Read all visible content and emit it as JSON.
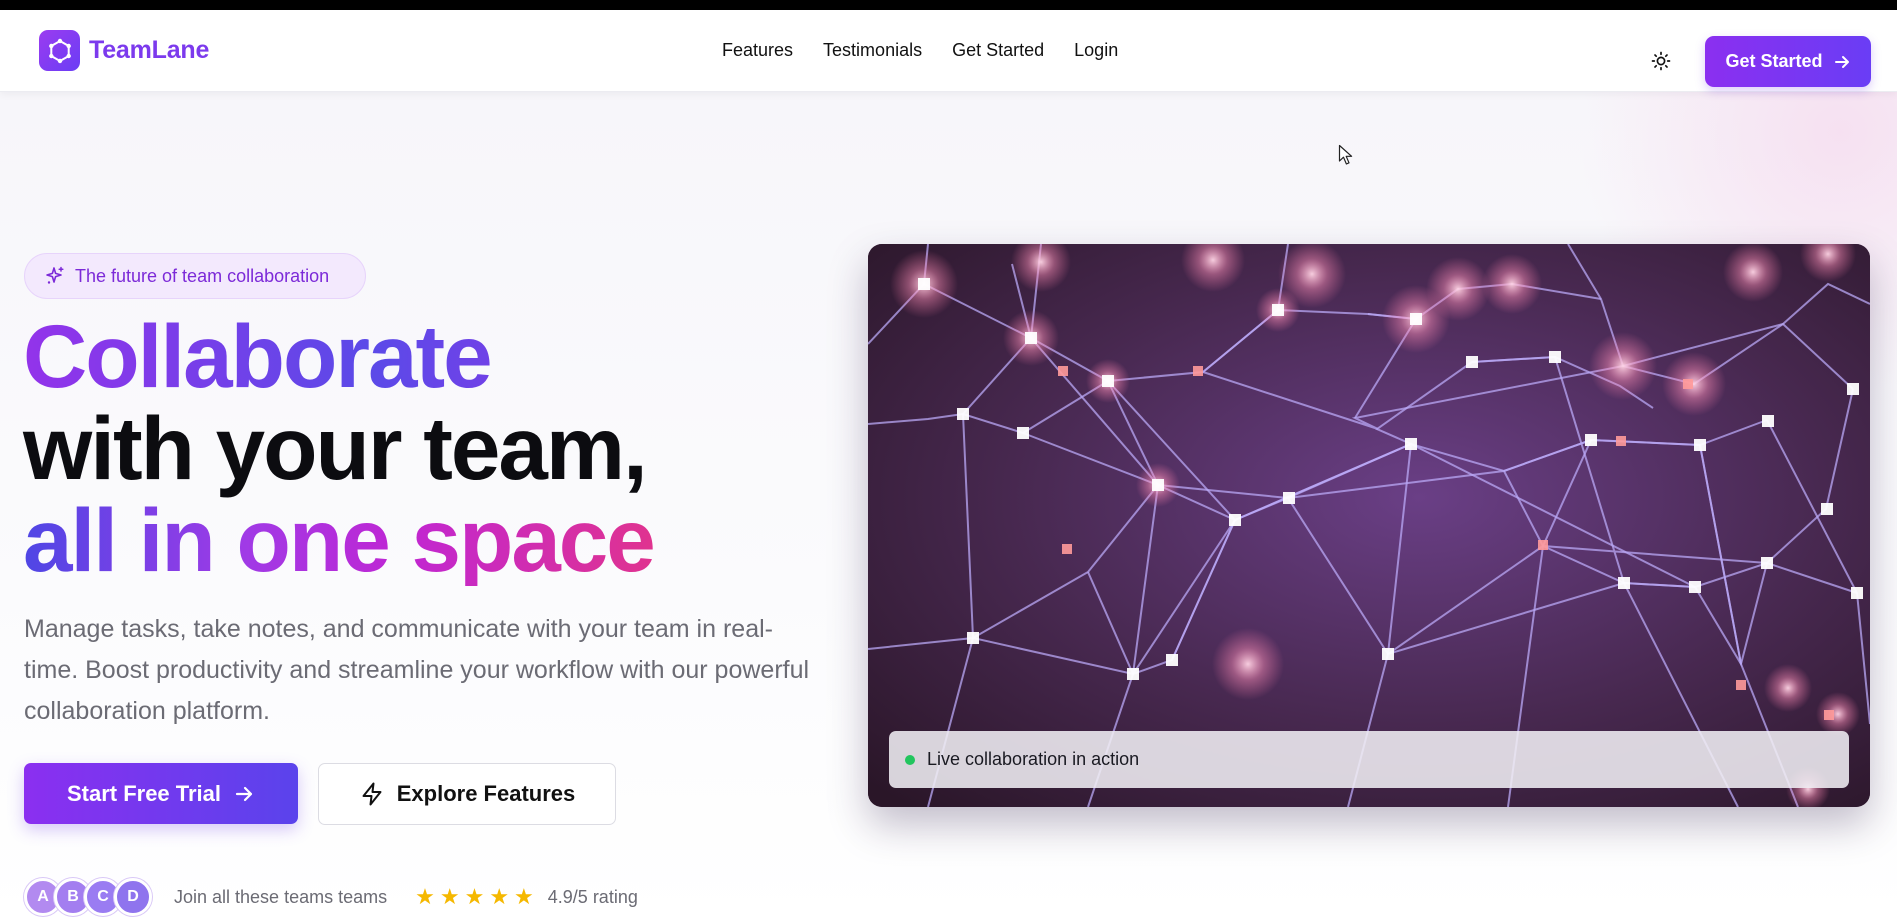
{
  "brand": {
    "name": "TeamLane",
    "logo_icon": "hexagon-network-icon"
  },
  "nav": {
    "links": [
      "Features",
      "Testimonials",
      "Get Started",
      "Login"
    ],
    "cta_label": "Get Started",
    "theme_icon": "sun-icon"
  },
  "hero": {
    "badge": "The future of team collaboration",
    "headline": {
      "line1": "Collaborate",
      "line2": "with your team,",
      "line3": "all in one space"
    },
    "subtext": "Manage tasks, take notes, and communicate with your team in real-time. Boost productivity and streamline your workflow with our powerful collaboration platform.",
    "primary_button": "Start Free Trial",
    "secondary_button": "Explore Features",
    "social": {
      "avatars": [
        "A",
        "B",
        "C",
        "D"
      ],
      "text": "Join all these teams teams",
      "stars": 5,
      "rating": "4.9/5 rating"
    },
    "media": {
      "overlay_text": "Live collaboration in action",
      "status_color": "#22c55e"
    }
  },
  "colors": {
    "accent": "#7c3aed",
    "accent_gradient_start": "#8b2ff0",
    "accent_gradient_end": "#5a43ec",
    "star": "#f5b800"
  }
}
